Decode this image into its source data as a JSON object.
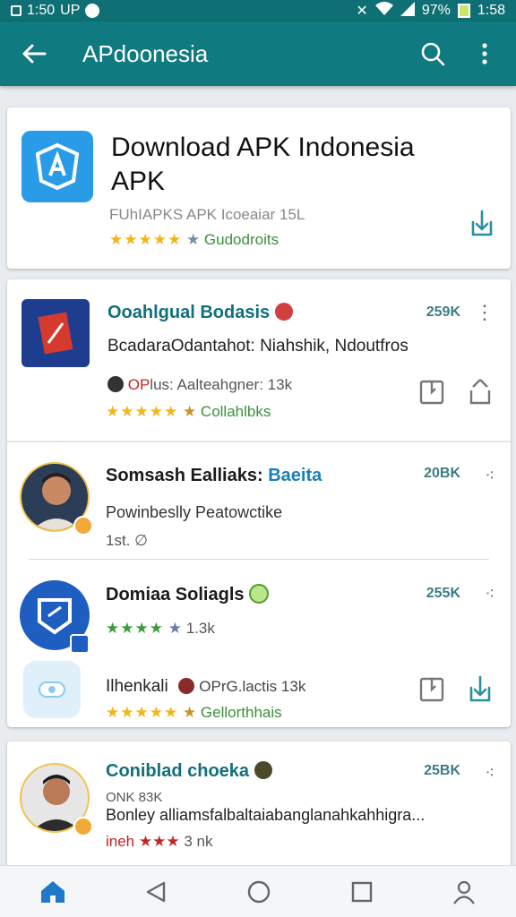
{
  "statusbar": {
    "left_text": "1:50",
    "left_label": "UP",
    "right_text": "97%",
    "time": "1:58"
  },
  "appbar": {
    "title": "APdoonesia"
  },
  "hero": {
    "title": "Download APK Indonesia APK",
    "meta": "FUhIAPKS APK Icoeaiar 15L",
    "rating_label": "Gudodroits"
  },
  "apps": [
    {
      "name": "Ooahlgual Bodasis",
      "size": "259K",
      "desc": "BcadaraOdantahot: Niahshik, Ndoutfros",
      "meta_prefix": "OP",
      "meta": "lus: Aalteahgner: 13k",
      "rating_label": "Collahlbks"
    },
    {
      "name": "Somsash Ealliaks:",
      "name_accent": "Baeita",
      "size": "20BK",
      "desc": "Powinbeslly Peatowctike",
      "meta": "1st. ∅"
    },
    {
      "name": "Domiaa Soliagls",
      "size": "255K",
      "rating_label": "1.3k",
      "sub_name": "Ilhenkali",
      "sub_meta": "OPrG.lactis 13k",
      "sub_rating_label": "Gellorthhais"
    },
    {
      "name": "Coniblad choeka",
      "size": "25BK",
      "meta": "ONK 83K",
      "desc": "Bonley alliamsfalbaltaiabanglanahkahhigra...",
      "rating_prefix": "ineh",
      "rating_label": "3 nk"
    }
  ],
  "colors": {
    "primary": "#0f7a80",
    "accent": "#2a9be6",
    "star": "#f3b51b"
  }
}
